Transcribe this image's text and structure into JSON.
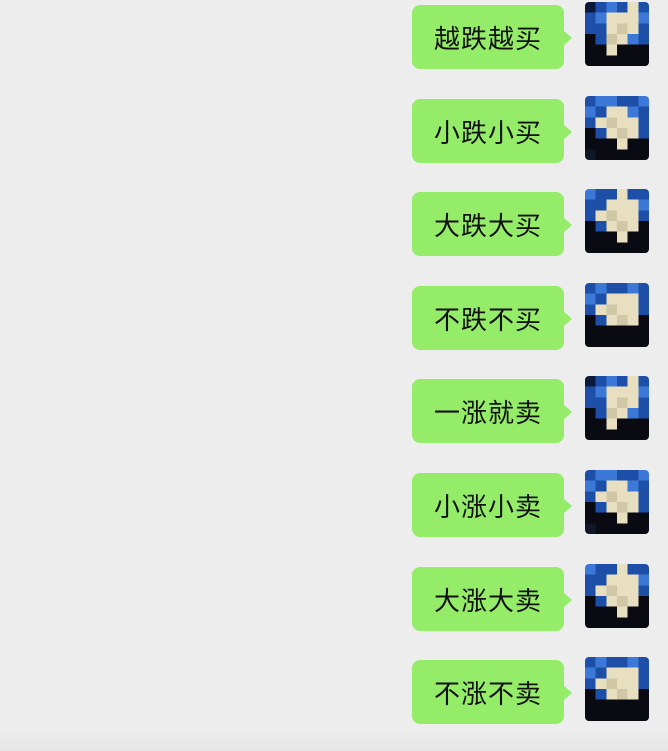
{
  "colors": {
    "background": "#EDEDED",
    "bubble": "#95EC69",
    "text": "#111111"
  },
  "messages": [
    {
      "text": "越跌越买",
      "sender": "self",
      "avatar_icon": "pixelated-avatar-icon"
    },
    {
      "text": "小跌小买",
      "sender": "self",
      "avatar_icon": "pixelated-avatar-icon"
    },
    {
      "text": "大跌大买",
      "sender": "self",
      "avatar_icon": "pixelated-avatar-icon"
    },
    {
      "text": "不跌不买",
      "sender": "self",
      "avatar_icon": "pixelated-avatar-icon"
    },
    {
      "text": "一涨就卖",
      "sender": "self",
      "avatar_icon": "pixelated-avatar-icon"
    },
    {
      "text": "小涨小卖",
      "sender": "self",
      "avatar_icon": "pixelated-avatar-icon"
    },
    {
      "text": "大涨大卖",
      "sender": "self",
      "avatar_icon": "pixelated-avatar-icon"
    },
    {
      "text": "不涨不卖",
      "sender": "self",
      "avatar_icon": "pixelated-avatar-icon"
    }
  ]
}
